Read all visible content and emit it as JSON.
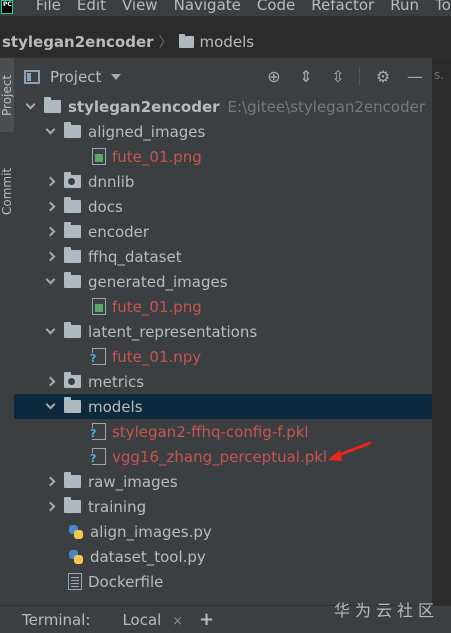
{
  "menubar": {
    "items": [
      "File",
      "Edit",
      "View",
      "Navigate",
      "Code",
      "Refactor",
      "Run",
      "Too"
    ]
  },
  "breadcrumb": {
    "project": "stylegan2encoder",
    "folder": "models"
  },
  "side_tabs": {
    "project": "Project",
    "commit": "Commit"
  },
  "panel": {
    "title": "Project"
  },
  "right_pane": {
    "tab_stub": "s."
  },
  "tree": {
    "root": {
      "name": "stylegan2encoder",
      "path": "E:\\gitee\\stylegan2encoder"
    },
    "rows": [
      {
        "name": "aligned_images"
      },
      {
        "name": "fute_01.png"
      },
      {
        "name": "dnnlib"
      },
      {
        "name": "docs"
      },
      {
        "name": "encoder"
      },
      {
        "name": "ffhq_dataset"
      },
      {
        "name": "generated_images"
      },
      {
        "name": "fute_01.png"
      },
      {
        "name": "latent_representations"
      },
      {
        "name": "fute_01.npy"
      },
      {
        "name": "metrics"
      },
      {
        "name": "models"
      },
      {
        "name": "stylegan2-ffhq-config-f.pkl"
      },
      {
        "name": "vgg16_zhang_perceptual.pkl"
      },
      {
        "name": "raw_images"
      },
      {
        "name": "training"
      },
      {
        "name": "align_images.py"
      },
      {
        "name": "dataset_tool.py"
      },
      {
        "name": "Dockerfile"
      }
    ]
  },
  "bottom": {
    "terminal_label": "Terminal:",
    "local_tab": "Local",
    "close": "×",
    "add": "+"
  },
  "watermark": "华为云社区",
  "colors": {
    "selected_row": "#0d293e",
    "changed_file": "#c75450",
    "panel_bg": "#3c3f41",
    "editor_bg": "#2b2b2b",
    "annotation": "#e8261c"
  }
}
